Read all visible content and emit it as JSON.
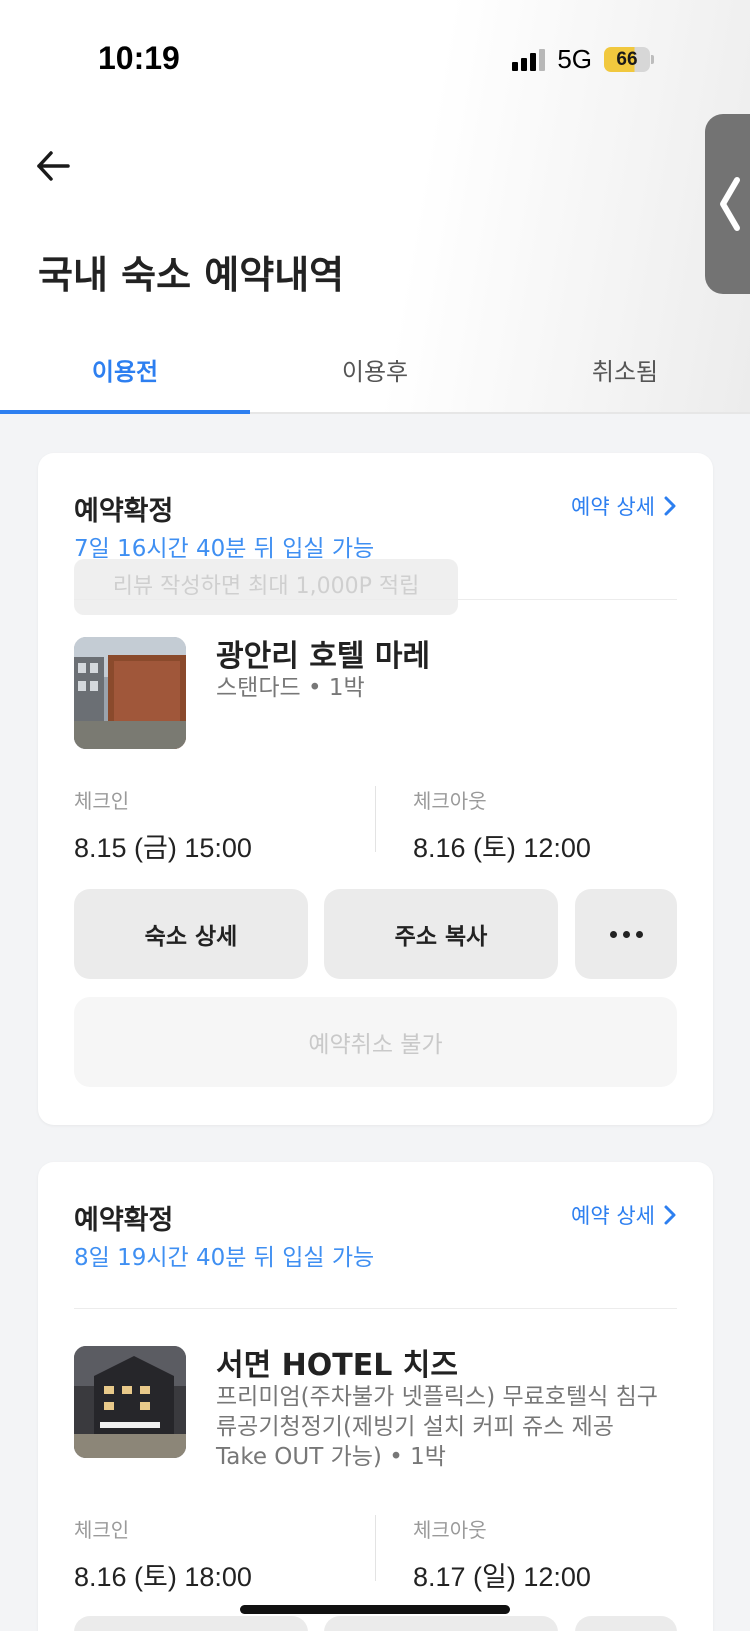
{
  "status_bar": {
    "time": "10:19",
    "network": "5G",
    "battery": "66"
  },
  "icons": {
    "back": "back-arrow-icon",
    "side_handle": "chevron-left-icon",
    "detail": "chevron-right-icon",
    "more": "more-icon"
  },
  "colors": {
    "accent": "#2d7ff0",
    "countdown": "#3f8ff2",
    "battery": "#f1c83e"
  },
  "header": {
    "title": "국내 숙소 예약내역"
  },
  "tabs": [
    {
      "label": "이용전",
      "active": true
    },
    {
      "label": "이용후",
      "active": false
    },
    {
      "label": "취소됨",
      "active": false
    }
  ],
  "reservations": [
    {
      "status": "예약확정",
      "detail_link": "예약 상세",
      "countdown": "7일 16시간 40분 뒤 입실 가능",
      "review_tooltip": "리뷰 작성하면 최대 1,000P 적립",
      "hotel_name": "광안리 호텔 마레",
      "room": "스탠다드 • 1박",
      "checkin_label": "체크인",
      "checkin": "8.15 (금) 15:00",
      "checkout_label": "체크아웃",
      "checkout": "8.16 (토) 12:00",
      "btn_detail": "숙소 상세",
      "btn_copy": "주소 복사",
      "cancel_label": "예약취소 불가"
    },
    {
      "status": "예약확정",
      "detail_link": "예약 상세",
      "countdown": "8일 19시간 40분 뒤 입실 가능",
      "hotel_name": "서면 HOTEL 치즈",
      "room": "프리미엄(주차불가 넷플릭스) 무료호텔식 침구류공기청정기(제빙기 설치 커피 쥬스 제공 Take OUT 가능) • 1박",
      "checkin_label": "체크인",
      "checkin": "8.16 (토) 18:00",
      "checkout_label": "체크아웃",
      "checkout": "8.17 (일) 12:00"
    }
  ]
}
